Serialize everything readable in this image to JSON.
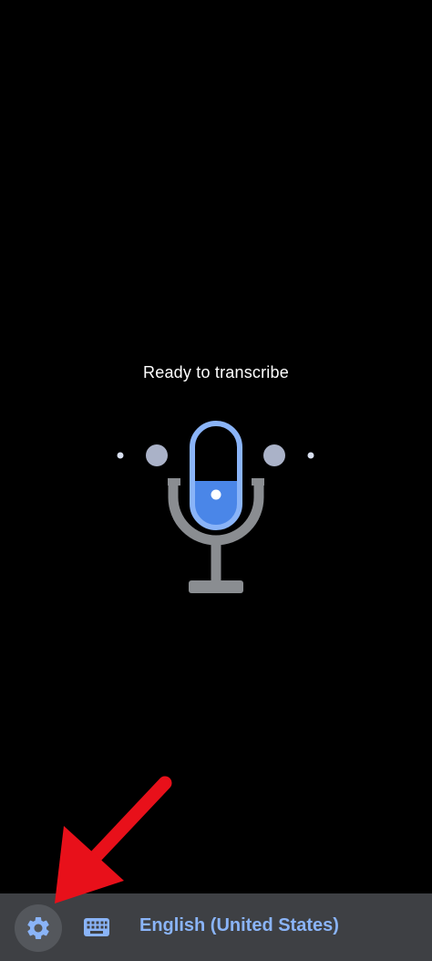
{
  "transcribe": {
    "status_text": "Ready to transcribe"
  },
  "microphone": {
    "icon": "microphone-icon",
    "capsule_color": "#4a86e8",
    "outline_color": "#8ab4f8",
    "stand_color": "#8a8d91",
    "level_dot_color": "#aab2c8"
  },
  "bottom_bar": {
    "settings_icon": "gear-icon",
    "keyboard_icon": "keyboard-icon",
    "language": "English (United States)",
    "language_color": "#8ab4f8"
  },
  "annotation": {
    "icon": "red-arrow-icon",
    "color": "#e8101a"
  }
}
